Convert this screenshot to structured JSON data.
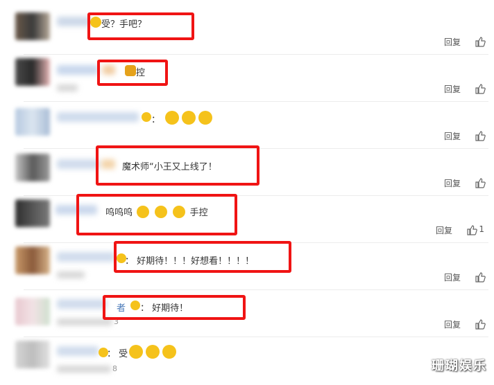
{
  "comments": [
    {
      "text": "受？手吧？",
      "reply": "回复",
      "like_count": ""
    },
    {
      "text": "控",
      "reply": "回复",
      "like_count": ""
    },
    {
      "text": "：",
      "reply": "回复",
      "like_count": ""
    },
    {
      "text": "魔术师“小王又上线了！",
      "reply": "回复",
      "like_count": ""
    },
    {
      "text_pre": "呜呜呜",
      "text_post": "手控",
      "reply": "回复",
      "like_count": "1"
    },
    {
      "text": "：  好期待！！！好想看！！！！",
      "reply": "回复",
      "like_count": ""
    },
    {
      "name_tail": "者",
      "text": "：  好期待！",
      "reply": "回复",
      "like_count": ""
    },
    {
      "text": "：  受",
      "reply": "回复",
      "like_count": ""
    }
  ],
  "meta_fragments": {
    "r6": "3",
    "r7": "8"
  },
  "watermark": "珊瑚娱乐",
  "colors": {
    "highlight": "#f01414",
    "link": "#4a7ab8",
    "emoji": "#f5c21b"
  }
}
